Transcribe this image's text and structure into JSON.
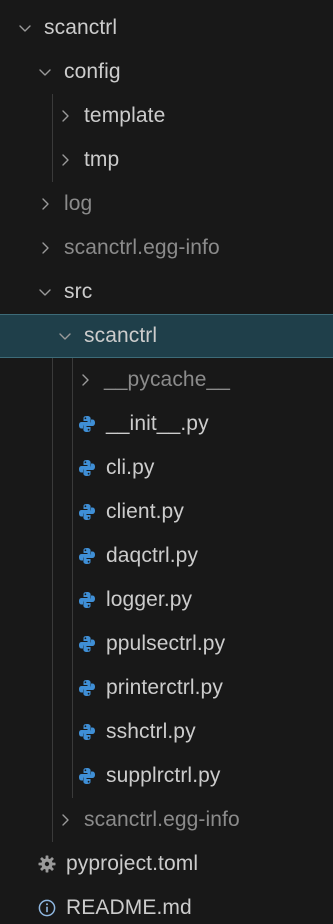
{
  "explorer": {
    "colors": {
      "background": "#181818",
      "text": "#cccccc",
      "dim_text": "#8b8b8b",
      "selected_background": "#1f3f4a",
      "python_icon": "#3f8fd6",
      "chevron": "#9a9a9a"
    },
    "items": [
      {
        "label": "scanctrl",
        "kind": "folder",
        "expanded": true,
        "depth": 0
      },
      {
        "label": "config",
        "kind": "folder",
        "expanded": true,
        "depth": 1
      },
      {
        "label": "template",
        "kind": "folder",
        "expanded": false,
        "depth": 2
      },
      {
        "label": "tmp",
        "kind": "folder",
        "expanded": false,
        "depth": 2
      },
      {
        "label": "log",
        "kind": "folder",
        "expanded": false,
        "depth": 1,
        "dim": true
      },
      {
        "label": "scanctrl.egg-info",
        "kind": "folder",
        "expanded": false,
        "depth": 1,
        "dim": true
      },
      {
        "label": "src",
        "kind": "folder",
        "expanded": true,
        "depth": 1
      },
      {
        "label": "scanctrl",
        "kind": "folder",
        "expanded": true,
        "depth": 2,
        "selected": true
      },
      {
        "label": "__pycache__",
        "kind": "folder",
        "expanded": false,
        "depth": 3,
        "dim": true
      },
      {
        "label": "__init__.py",
        "kind": "python-file",
        "depth": 3
      },
      {
        "label": "cli.py",
        "kind": "python-file",
        "depth": 3
      },
      {
        "label": "client.py",
        "kind": "python-file",
        "depth": 3
      },
      {
        "label": "daqctrl.py",
        "kind": "python-file",
        "depth": 3
      },
      {
        "label": "logger.py",
        "kind": "python-file",
        "depth": 3
      },
      {
        "label": "ppulsectrl.py",
        "kind": "python-file",
        "depth": 3
      },
      {
        "label": "printerctrl.py",
        "kind": "python-file",
        "depth": 3
      },
      {
        "label": "sshctrl.py",
        "kind": "python-file",
        "depth": 3
      },
      {
        "label": "supplrctrl.py",
        "kind": "python-file",
        "depth": 3
      },
      {
        "label": "scanctrl.egg-info",
        "kind": "folder",
        "expanded": false,
        "depth": 2,
        "dim": true
      },
      {
        "label": "pyproject.toml",
        "kind": "settings-file",
        "depth": 1
      },
      {
        "label": "README.md",
        "kind": "info-file",
        "depth": 1
      }
    ]
  }
}
